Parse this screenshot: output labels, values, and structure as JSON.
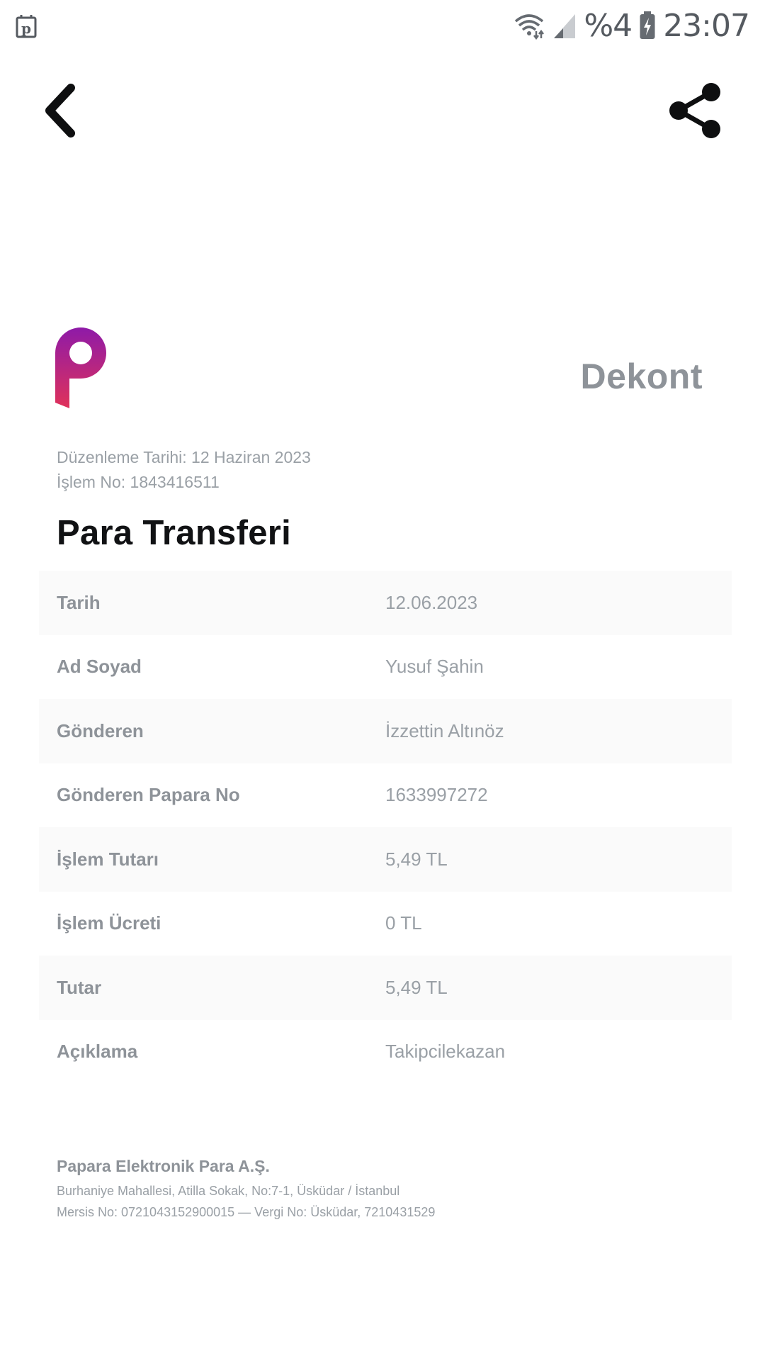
{
  "status_bar": {
    "app_icon": "papara-notification-icon",
    "wifi_icon": "wifi-icon",
    "signal_icon": "cellular-signal-icon",
    "battery_text": "%4",
    "battery_icon": "battery-charging-icon",
    "time": "23:07"
  },
  "nav": {
    "back_icon": "chevron-left-icon",
    "share_icon": "share-icon"
  },
  "receipt": {
    "logo": "papara-logo",
    "doc_title": "Dekont",
    "issue_date": "Düzenleme Tarihi: 12 Haziran 2023",
    "transaction_no": "İşlem No: 1843416511",
    "section_title": "Para Transferi",
    "rows": [
      {
        "label": "Tarih",
        "value": "12.06.2023"
      },
      {
        "label": "Ad Soyad",
        "value": "Yusuf Şahin"
      },
      {
        "label": "Gönderen",
        "value": "İzzettin Altınöz"
      },
      {
        "label": "Gönderen Papara No",
        "value": "1633997272"
      },
      {
        "label": "İşlem Tutarı",
        "value": "5,49 TL"
      },
      {
        "label": "İşlem Ücreti",
        "value": "0 TL"
      },
      {
        "label": "Tutar",
        "value": "5,49 TL"
      },
      {
        "label": "Açıklama",
        "value": "Takipcilekazan"
      }
    ]
  },
  "footer": {
    "company": "Papara Elektronik Para A.Ş.",
    "address": "Burhaniye Mahallesi, Atilla Sokak, No:7-1, Üsküdar / İstanbul",
    "registry": "Mersis No: 0721043152900015 — Vergi No: Üsküdar, 7210431529"
  },
  "colors": {
    "brand_gradient_top": "#8e1aa8",
    "brand_gradient_bottom": "#e0325a",
    "label_gray": "#8e9399",
    "value_gray": "#9aa0a6",
    "title_black": "#111214",
    "row_stripe": "#fafafa"
  }
}
